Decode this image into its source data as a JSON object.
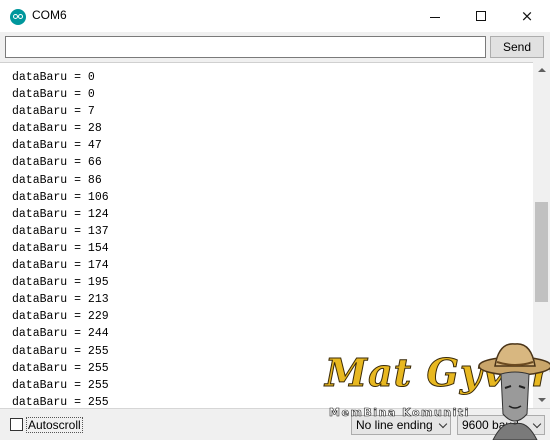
{
  "window": {
    "title": "COM6",
    "controls": {
      "minimize": "minimize-icon",
      "maximize": "maximize-icon",
      "close": "×"
    }
  },
  "toolbar": {
    "input_value": "",
    "send_label": "Send"
  },
  "output": {
    "lines": [
      "dataBaru = 0",
      "dataBaru = 0",
      "dataBaru = 7",
      "dataBaru = 28",
      "dataBaru = 47",
      "dataBaru = 66",
      "dataBaru = 86",
      "dataBaru = 106",
      "dataBaru = 124",
      "dataBaru = 137",
      "dataBaru = 154",
      "dataBaru = 174",
      "dataBaru = 195",
      "dataBaru = 213",
      "dataBaru = 229",
      "dataBaru = 244",
      "dataBaru = 255",
      "dataBaru = 255",
      "dataBaru = 255",
      "dataBaru = 255"
    ]
  },
  "statusbar": {
    "autoscroll_label": "Autoscroll",
    "autoscroll_checked": false,
    "line_ending": "No line ending",
    "baud_rate": "9600 baud"
  },
  "watermark": {
    "title": "Mat Gyver",
    "subtitle": "MemBina Komuniti"
  },
  "colors": {
    "app_icon": "#00979c",
    "watermark_gold": "#e8b820"
  }
}
